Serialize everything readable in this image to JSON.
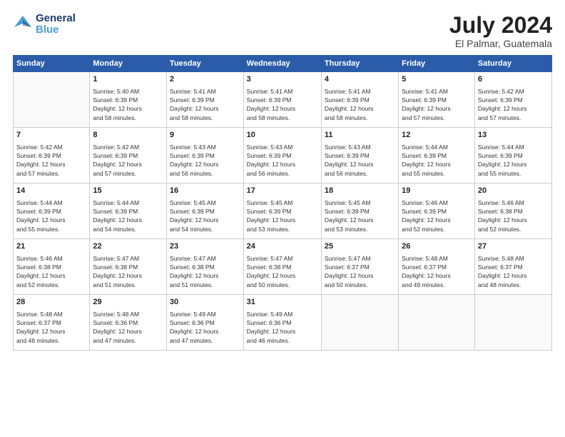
{
  "header": {
    "logo_general": "General",
    "logo_blue": "Blue",
    "month_year": "July 2024",
    "location": "El Palmar, Guatemala"
  },
  "weekdays": [
    "Sunday",
    "Monday",
    "Tuesday",
    "Wednesday",
    "Thursday",
    "Friday",
    "Saturday"
  ],
  "weeks": [
    [
      {
        "day": "",
        "info": ""
      },
      {
        "day": "1",
        "info": "Sunrise: 5:40 AM\nSunset: 6:39 PM\nDaylight: 12 hours\nand 58 minutes."
      },
      {
        "day": "2",
        "info": "Sunrise: 5:41 AM\nSunset: 6:39 PM\nDaylight: 12 hours\nand 58 minutes."
      },
      {
        "day": "3",
        "info": "Sunrise: 5:41 AM\nSunset: 6:39 PM\nDaylight: 12 hours\nand 58 minutes."
      },
      {
        "day": "4",
        "info": "Sunrise: 5:41 AM\nSunset: 6:39 PM\nDaylight: 12 hours\nand 58 minutes."
      },
      {
        "day": "5",
        "info": "Sunrise: 5:41 AM\nSunset: 6:39 PM\nDaylight: 12 hours\nand 57 minutes."
      },
      {
        "day": "6",
        "info": "Sunrise: 5:42 AM\nSunset: 6:39 PM\nDaylight: 12 hours\nand 57 minutes."
      }
    ],
    [
      {
        "day": "7",
        "info": "Sunrise: 5:42 AM\nSunset: 6:39 PM\nDaylight: 12 hours\nand 57 minutes."
      },
      {
        "day": "8",
        "info": "Sunrise: 5:42 AM\nSunset: 6:39 PM\nDaylight: 12 hours\nand 57 minutes."
      },
      {
        "day": "9",
        "info": "Sunrise: 5:43 AM\nSunset: 6:39 PM\nDaylight: 12 hours\nand 56 minutes."
      },
      {
        "day": "10",
        "info": "Sunrise: 5:43 AM\nSunset: 6:39 PM\nDaylight: 12 hours\nand 56 minutes."
      },
      {
        "day": "11",
        "info": "Sunrise: 5:43 AM\nSunset: 6:39 PM\nDaylight: 12 hours\nand 56 minutes."
      },
      {
        "day": "12",
        "info": "Sunrise: 5:44 AM\nSunset: 6:39 PM\nDaylight: 12 hours\nand 55 minutes."
      },
      {
        "day": "13",
        "info": "Sunrise: 5:44 AM\nSunset: 6:39 PM\nDaylight: 12 hours\nand 55 minutes."
      }
    ],
    [
      {
        "day": "14",
        "info": "Sunrise: 5:44 AM\nSunset: 6:39 PM\nDaylight: 12 hours\nand 55 minutes."
      },
      {
        "day": "15",
        "info": "Sunrise: 5:44 AM\nSunset: 6:39 PM\nDaylight: 12 hours\nand 54 minutes."
      },
      {
        "day": "16",
        "info": "Sunrise: 5:45 AM\nSunset: 6:39 PM\nDaylight: 12 hours\nand 54 minutes."
      },
      {
        "day": "17",
        "info": "Sunrise: 5:45 AM\nSunset: 6:39 PM\nDaylight: 12 hours\nand 53 minutes."
      },
      {
        "day": "18",
        "info": "Sunrise: 5:45 AM\nSunset: 6:39 PM\nDaylight: 12 hours\nand 53 minutes."
      },
      {
        "day": "19",
        "info": "Sunrise: 5:46 AM\nSunset: 6:39 PM\nDaylight: 12 hours\nand 52 minutes."
      },
      {
        "day": "20",
        "info": "Sunrise: 5:46 AM\nSunset: 6:38 PM\nDaylight: 12 hours\nand 52 minutes."
      }
    ],
    [
      {
        "day": "21",
        "info": "Sunrise: 5:46 AM\nSunset: 6:38 PM\nDaylight: 12 hours\nand 52 minutes."
      },
      {
        "day": "22",
        "info": "Sunrise: 5:47 AM\nSunset: 6:38 PM\nDaylight: 12 hours\nand 51 minutes."
      },
      {
        "day": "23",
        "info": "Sunrise: 5:47 AM\nSunset: 6:38 PM\nDaylight: 12 hours\nand 51 minutes."
      },
      {
        "day": "24",
        "info": "Sunrise: 5:47 AM\nSunset: 6:38 PM\nDaylight: 12 hours\nand 50 minutes."
      },
      {
        "day": "25",
        "info": "Sunrise: 5:47 AM\nSunset: 6:37 PM\nDaylight: 12 hours\nand 50 minutes."
      },
      {
        "day": "26",
        "info": "Sunrise: 5:48 AM\nSunset: 6:37 PM\nDaylight: 12 hours\nand 49 minutes."
      },
      {
        "day": "27",
        "info": "Sunrise: 5:48 AM\nSunset: 6:37 PM\nDaylight: 12 hours\nand 48 minutes."
      }
    ],
    [
      {
        "day": "28",
        "info": "Sunrise: 5:48 AM\nSunset: 6:37 PM\nDaylight: 12 hours\nand 48 minutes."
      },
      {
        "day": "29",
        "info": "Sunrise: 5:48 AM\nSunset: 6:36 PM\nDaylight: 12 hours\nand 47 minutes."
      },
      {
        "day": "30",
        "info": "Sunrise: 5:49 AM\nSunset: 6:36 PM\nDaylight: 12 hours\nand 47 minutes."
      },
      {
        "day": "31",
        "info": "Sunrise: 5:49 AM\nSunset: 6:36 PM\nDaylight: 12 hours\nand 46 minutes."
      },
      {
        "day": "",
        "info": ""
      },
      {
        "day": "",
        "info": ""
      },
      {
        "day": "",
        "info": ""
      }
    ]
  ]
}
